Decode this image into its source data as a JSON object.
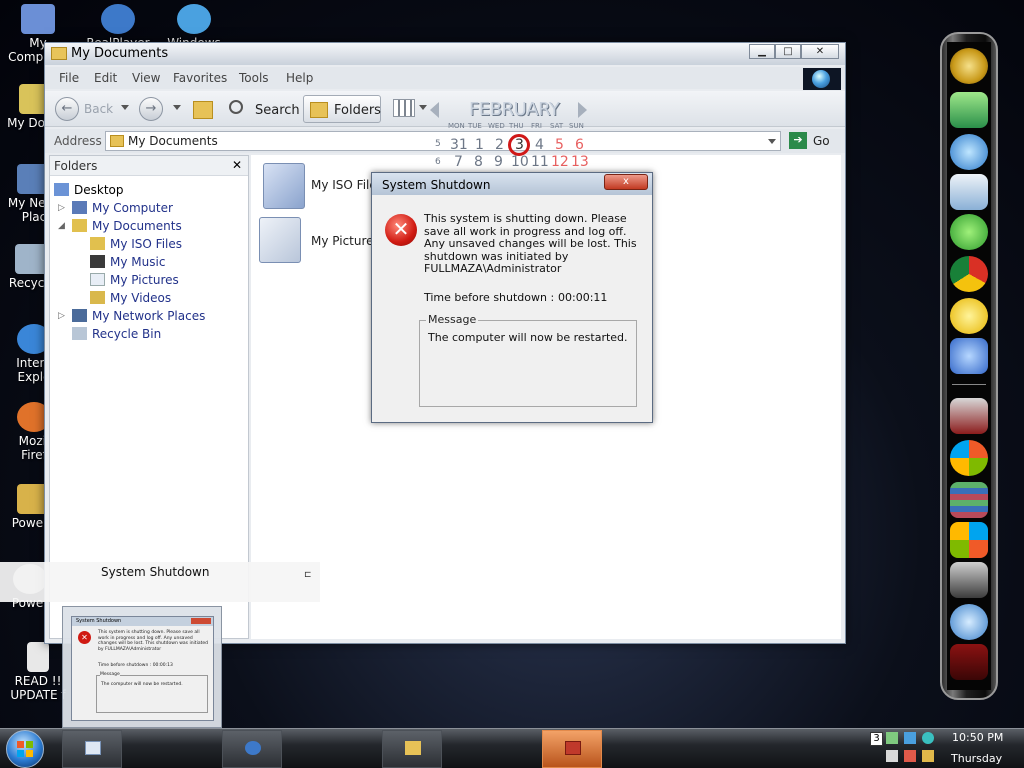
{
  "desktop_icons": [
    {
      "label": "My Computer",
      "color": "#6b8fd6"
    },
    {
      "label": "RealPlayer",
      "color": "#3d79c9"
    },
    {
      "label": "Windows Live Mes...",
      "color": "#4aa1e0"
    },
    {
      "label": "My Docum",
      "color": "#d9c35a"
    },
    {
      "label": "My Netw Plac",
      "color": "#5a7fb8"
    },
    {
      "label": "Recycle",
      "color": "#9fb4c9"
    },
    {
      "label": "Intern Explo",
      "color": "#3a86d8"
    },
    {
      "label": "Mozil Firef",
      "color": "#e0722a"
    },
    {
      "label": "PowerA",
      "color": "#d8b24a"
    },
    {
      "label": "Power",
      "color": "#c0c0c0"
    },
    {
      "label": "READ !! UPDATE f",
      "color": "#e8e8e8"
    }
  ],
  "window": {
    "title": "My Documents",
    "menu": [
      "File",
      "Edit",
      "View",
      "Favorites",
      "Tools",
      "Help"
    ],
    "toolbar": {
      "back": "Back",
      "search": "Search",
      "folders": "Folders"
    },
    "address_label": "Address",
    "address_value": "My Documents",
    "go": "Go"
  },
  "folders_pane": {
    "header": "Folders",
    "close": "✕",
    "tree": [
      {
        "label": "Desktop",
        "icon": "desktop-icon"
      },
      {
        "label": "My Computer",
        "icon": "computer-icon"
      },
      {
        "label": "My Documents",
        "icon": "folder-icon"
      },
      {
        "label": "My ISO Files",
        "icon": "folder-icon"
      },
      {
        "label": "My Music",
        "icon": "music-folder-icon"
      },
      {
        "label": "My Pictures",
        "icon": "pictures-folder-icon"
      },
      {
        "label": "My Videos",
        "icon": "videos-folder-icon"
      },
      {
        "label": "My Network Places",
        "icon": "network-icon"
      },
      {
        "label": "Recycle Bin",
        "icon": "recycle-bin-icon"
      }
    ]
  },
  "content": {
    "items": [
      "My ISO File",
      "My Pictures"
    ]
  },
  "calendar": {
    "month": "FEBRUARY",
    "days": [
      "MON",
      "TUE",
      "WED",
      "THU",
      "FRI",
      "SAT",
      "SUN"
    ],
    "row1": [
      "5",
      "31",
      "1",
      "2",
      "3",
      "4",
      "5",
      "6"
    ],
    "row2": [
      "6",
      "7",
      "8",
      "9",
      "10",
      "11",
      "12",
      "13"
    ],
    "today": "3"
  },
  "dialog": {
    "title": "System Shutdown",
    "close": "x",
    "message": "This system is shutting down. Please save all work in progress and log off. Any unsaved changes will be lost. This shutdown was initiated by FULLMAZA\\Administrator",
    "time_label": "Time before shutdown :",
    "time_value": "00:00:11",
    "group_label": "Message",
    "group_text": "The computer will now be restarted."
  },
  "preview": {
    "title": "System Shutdown",
    "mini_title": "System Shutdown",
    "mini_message": "This system is shutting down. Please save all work in progress and log off. Any unsaved changes will be lost. This shutdown was initiated by FULLMAZA\\Administrator",
    "mini_time": "Time before shutdown :      00:00:13",
    "mini_group_label": "Message",
    "mini_group_text": "The computer will now be restarted."
  },
  "taskbar": {
    "clock_time": "10:50 PM",
    "clock_day": "Thursday",
    "tray_date": "3"
  },
  "colors": {
    "accent_red": "#d01a12",
    "taskbar_active": "#d8742f",
    "tree_link": "#22328a"
  }
}
